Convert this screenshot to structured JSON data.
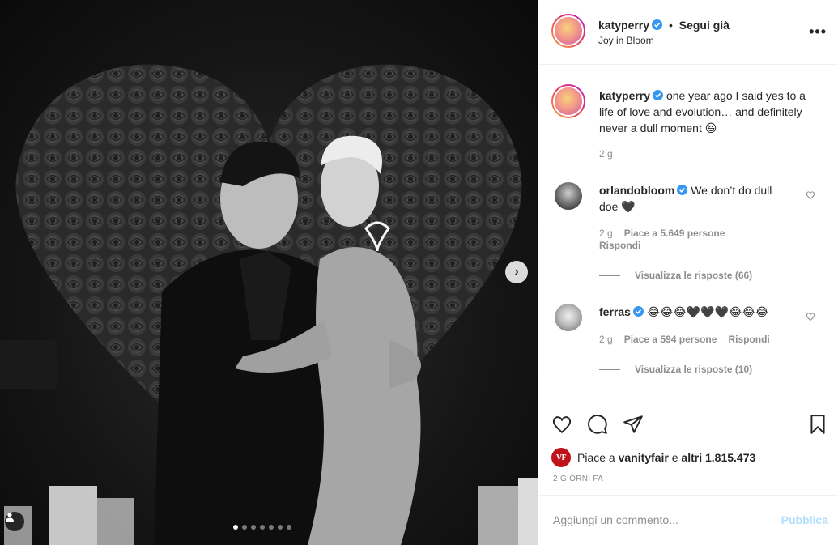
{
  "post": {
    "dots_count": 7,
    "active_dot": 0
  },
  "header": {
    "username": "katyperry",
    "separator": "•",
    "follow_label": "Segui già",
    "location": "Joy in Bloom",
    "more_icon": "more-horizontal-icon"
  },
  "caption": {
    "username": "katyperry",
    "text": "one year ago I said yes to a life of love and evolution… and definitely never a dull moment 😆",
    "time": "2 g"
  },
  "comments": [
    {
      "username": "orlandobloom",
      "text": "We don’t do dull doe 🖤",
      "time": "2 g",
      "likes": "Piace a 5.649 persone",
      "reply": "Rispondi",
      "view_replies": "Visualizza le risposte (66)"
    },
    {
      "username": "ferras",
      "text": "😂😂😂🖤🖤🖤😂😂😂",
      "time": "2 g",
      "likes": "Piace a 594 persone",
      "reply": "Rispondi",
      "view_replies": "Visualizza le risposte (10)"
    }
  ],
  "actions": {
    "icons": [
      "heart-icon",
      "comment-icon",
      "share-icon",
      "bookmark-icon"
    ],
    "liked_by_prefix": "Piace a",
    "liked_by_user": "vanityfair",
    "liked_by_suffix": "e",
    "liked_by_others": "altri 1.815.473",
    "vf_badge": "VF",
    "date": "2 GIORNI FA"
  },
  "add_comment": {
    "placeholder": "Aggiungi un commento...",
    "post_label": "Pubblica"
  },
  "colors": {
    "verified": "#3897f0",
    "muted": "#8e8e8e",
    "post_disabled": "#b2dffc",
    "vf_red": "#c0121b"
  }
}
